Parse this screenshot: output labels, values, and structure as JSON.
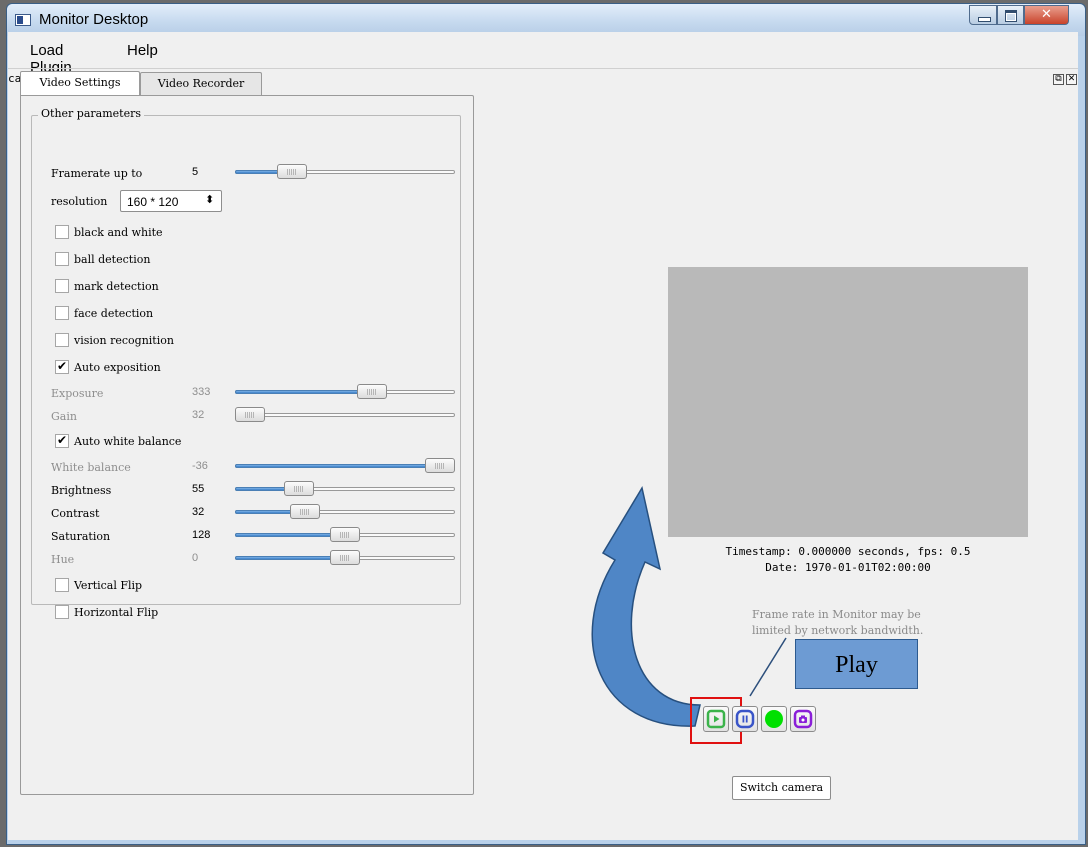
{
  "window": {
    "title": "Monitor Desktop"
  },
  "menu": [
    "Load Plugin",
    "Help"
  ],
  "dock": {
    "title": "cameraviewer"
  },
  "tabs": [
    "Video Settings",
    "Video Recorder"
  ],
  "group": {
    "title": "Other parameters"
  },
  "framerate": {
    "label": "Framerate up to",
    "value": "5",
    "level": 0.22
  },
  "resolution": {
    "label": "resolution",
    "value": "160 * 120"
  },
  "checkboxes": [
    {
      "label": "black and white",
      "checked": false
    },
    {
      "label": "ball detection",
      "checked": false
    },
    {
      "label": "mark detection",
      "checked": false
    },
    {
      "label": "face detection",
      "checked": false
    },
    {
      "label": "vision recognition",
      "checked": false
    },
    {
      "label": "Auto exposition",
      "checked": true
    }
  ],
  "exposure": {
    "label": "Exposure",
    "value": "333",
    "level": 0.64,
    "disabled": true
  },
  "gain": {
    "label": "Gain",
    "value": "32",
    "level": 0.0,
    "disabled": true
  },
  "auto_white_balance": {
    "label": "Auto white balance",
    "checked": true
  },
  "white_balance": {
    "label": "White balance",
    "value": "-36",
    "level": 1.0,
    "disabled": true
  },
  "brightness": {
    "label": "Brightness",
    "value": "55",
    "level": 0.26
  },
  "contrast": {
    "label": "Contrast",
    "value": "32",
    "level": 0.29
  },
  "saturation": {
    "label": "Saturation",
    "value": "128",
    "level": 0.5
  },
  "hue": {
    "label": "Hue",
    "value": "0",
    "level": 0.5,
    "disabled": true
  },
  "flips": [
    {
      "label": "Vertical Flip",
      "checked": false
    },
    {
      "label": "Horizontal Flip",
      "checked": false
    }
  ],
  "viewer": {
    "timestamp": "Timestamp: 0.000000 seconds,  fps: 0.5",
    "date": "Date: 1970-01-01T02:00:00",
    "note_line1": "Frame rate in Monitor may be",
    "note_line2": "limited by network bandwidth.",
    "switch_camera": "Switch camera"
  },
  "annotation": {
    "label": "Play"
  },
  "colors": {
    "slider_fill": "#3a7fc8",
    "play": "#3bb34a",
    "pause": "#3a55c8",
    "record": "#00e000",
    "snapshot": "#8a1fd8",
    "highlight": "#e01010",
    "arrow": "#4f86c6"
  }
}
